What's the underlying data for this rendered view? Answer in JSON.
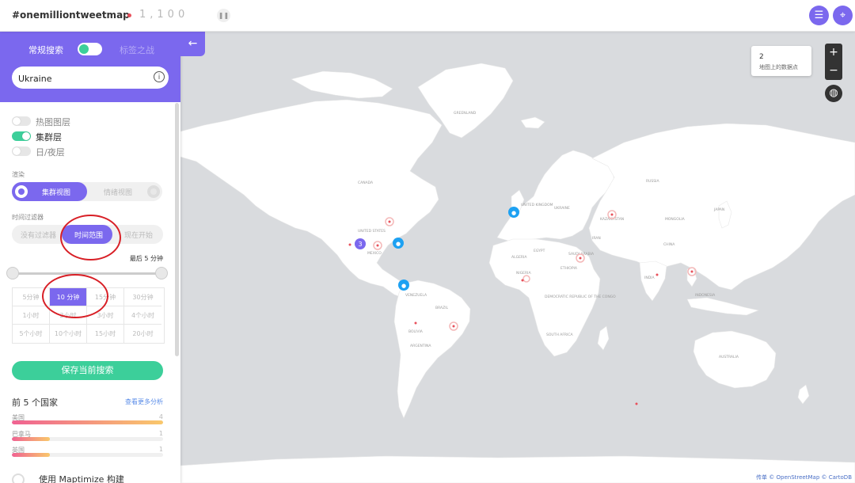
{
  "header": {
    "logo": "#onemilliontweetmap",
    "counter": "1,100",
    "pause_icon": "pause-icon",
    "list_icon": "list-icon",
    "location_icon": "location-pin-icon"
  },
  "panel": {
    "mode_left": "常规搜索",
    "mode_right": "标签之战",
    "search_value": "Ukraine",
    "layers": [
      "热图图层",
      "集群层",
      "日/夜层"
    ],
    "render_title": "渲染",
    "render_on": "集群视图",
    "render_off": "情绪视图",
    "time_filter_title": "时间过滤器",
    "time_options": [
      "没有过滤器",
      "时间范围",
      "现在开始"
    ],
    "last_label": "最后 5 分钟",
    "grid": [
      "5分钟",
      "10 分钟",
      "15分钟",
      "30分钟",
      "1小时",
      "2小时",
      "3小时",
      "4个小时",
      "5个小时",
      "10个小时",
      "15小时",
      "20小时"
    ],
    "save_button": "保存当前搜索",
    "top_countries_title": "前 5 个国家",
    "more_link": "查看更多分析",
    "countries": [
      {
        "name": "美国",
        "count": "4",
        "fraction": 1.0
      },
      {
        "name": "巴拿马",
        "count": "1",
        "fraction": 0.25
      },
      {
        "name": "英国",
        "count": "1",
        "fraction": 0.25
      }
    ],
    "built_with": "使用 Maptimize 构建",
    "collapse_icon": "arrow-left-icon"
  },
  "map": {
    "info_count": "2",
    "info_label": "地图上的数据点",
    "zoom_in": "+",
    "zoom_out": "−",
    "cluster_count": "3",
    "attribution_prefix": "传单",
    "attribution_osm": "© OpenStreetMap",
    "attribution_carto": "© CartoDB",
    "accent": "#7b68ee",
    "green": "#3ccf9a",
    "twitter_blue": "#1da1f2",
    "labels": [
      "GREENLAND",
      "ICELAND",
      "UNITED KINGDOM",
      "UNITED STATES",
      "MEXICO",
      "CANADA",
      "BRAZIL",
      "VENEZUELA",
      "COLOMBIA",
      "PERU",
      "BOLIVIA",
      "PARAGUAY",
      "ARGENTINA",
      "CHILE",
      "NIGERIA",
      "ETHIOPIA",
      "KENYA",
      "TANZANIA",
      "ANGOLA",
      "NAMIBIA",
      "SOUTH AFRICA",
      "DEMOCRATIC REPUBLIC OF THE CONGO",
      "ALGERIA",
      "LIBYA",
      "EGYPT",
      "SUDAN",
      "MALI",
      "NIGER",
      "CHAD",
      "MAURITANIA",
      "SAUDI ARABIA",
      "IRAN",
      "KAZAKHSTAN",
      "MONGOLIA",
      "CHINA",
      "INDIA",
      "PAKISTAN",
      "AFGHANISTAN",
      "BANGLADESH",
      "RUSSIA",
      "FINLAND",
      "NORWAY",
      "SWEDEN",
      "UKRAINE",
      "TURKEY",
      "AUSTRALIA",
      "INDONESIA",
      "MADAGASCAR",
      "JAPAN",
      "PHILIPPINES",
      "NEW ZEALAND"
    ]
  }
}
